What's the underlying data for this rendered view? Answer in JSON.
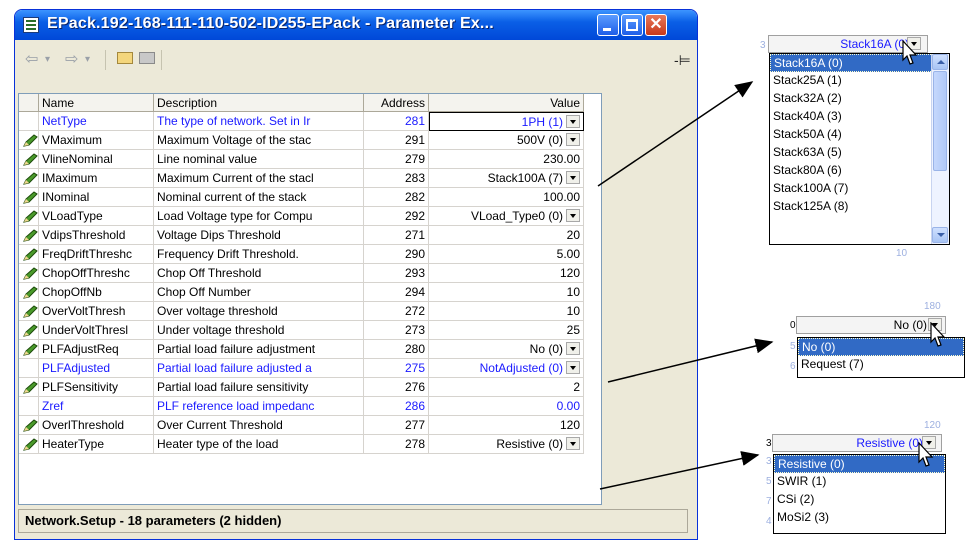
{
  "window": {
    "title": "EPack.192-168-111-110-502-ID255-EPack - Parameter Ex...",
    "close_glyph": "✕"
  },
  "toolbar": {
    "back_icon": "⇦",
    "forward_icon": "⇨",
    "dropdown_icon": "▾",
    "pin_icon": "-⊨"
  },
  "grid": {
    "columns": [
      "Name",
      "Description",
      "Address",
      "Value"
    ],
    "rows": [
      {
        "name": "NetType",
        "description": "The type of network. Set in Ir",
        "address": "281",
        "value": "1PH (1)",
        "editable": false,
        "dropdown": true
      },
      {
        "name": "VMaximum",
        "description": "Maximum Voltage of the stac",
        "address": "291",
        "value": "500V (0)",
        "editable": true,
        "dropdown": true
      },
      {
        "name": "VlineNominal",
        "description": "Line nominal value",
        "address": "279",
        "value": "230.00",
        "editable": true,
        "dropdown": false
      },
      {
        "name": "IMaximum",
        "description": "Maximum Current of the stacl",
        "address": "283",
        "value": "Stack100A (7)",
        "editable": true,
        "dropdown": true
      },
      {
        "name": "INominal",
        "description": "Nominal current of the stack",
        "address": "282",
        "value": "100.00",
        "editable": true,
        "dropdown": false
      },
      {
        "name": "VLoadType",
        "description": "Load Voltage type for Compu",
        "address": "292",
        "value": "VLoad_Type0 (0)",
        "editable": true,
        "dropdown": true
      },
      {
        "name": "VdipsThreshold",
        "description": "Voltage Dips Threshold",
        "address": "271",
        "value": "20",
        "editable": true,
        "dropdown": false
      },
      {
        "name": "FreqDriftThreshc",
        "description": "Frequency Drift Threshold.",
        "address": "290",
        "value": "5.00",
        "editable": true,
        "dropdown": false
      },
      {
        "name": "ChopOffThreshc",
        "description": "Chop Off Threshold",
        "address": "293",
        "value": "120",
        "editable": true,
        "dropdown": false
      },
      {
        "name": "ChopOffNb",
        "description": "Chop Off Number",
        "address": "294",
        "value": "10",
        "editable": true,
        "dropdown": false
      },
      {
        "name": "OverVoltThresh",
        "description": "Over voltage threshold",
        "address": "272",
        "value": "10",
        "editable": true,
        "dropdown": false
      },
      {
        "name": "UnderVoltThresl",
        "description": "Under voltage threshold",
        "address": "273",
        "value": "25",
        "editable": true,
        "dropdown": false
      },
      {
        "name": "PLFAdjustReq",
        "description": "Partial load failure adjustment",
        "address": "280",
        "value": "No (0)",
        "editable": true,
        "dropdown": true
      },
      {
        "name": "PLFAdjusted",
        "description": "Partial load failure adjusted a",
        "address": "275",
        "value": "NotAdjusted (0)",
        "editable": false,
        "dropdown": true
      },
      {
        "name": "PLFSensitivity",
        "description": "Partial load failure sensitivity",
        "address": "276",
        "value": "2",
        "editable": true,
        "dropdown": false
      },
      {
        "name": "Zref",
        "description": "PLF reference load impedanc",
        "address": "286",
        "value": "0.00",
        "editable": false,
        "dropdown": false
      },
      {
        "name": "OverlThreshold",
        "description": "Over Current Threshold",
        "address": "277",
        "value": "120",
        "editable": true,
        "dropdown": false
      },
      {
        "name": "HeaterType",
        "description": "Heater type of the load",
        "address": "278",
        "value": "Resistive (0)",
        "editable": true,
        "dropdown": true
      }
    ]
  },
  "status": {
    "text": "Network.Setup  -  18 parameters (2 hidden)"
  },
  "popups": {
    "stack": {
      "header": "Stack16A (0)",
      "options": [
        "Stack16A (0)",
        "Stack25A (1)",
        "Stack32A (2)",
        "Stack40A (3)",
        "Stack50A (4)",
        "Stack63A (5)",
        "Stack80A (6)",
        "Stack100A (7)",
        "Stack125A (8)"
      ],
      "edge_left": "3",
      "edge_bottom": "10"
    },
    "plf": {
      "header": "No (0)",
      "options": [
        "No (0)",
        "Request (7)"
      ],
      "edge_top": "180",
      "edge_left": [
        "0",
        "5",
        "6"
      ]
    },
    "heater": {
      "header": "Resistive (0)",
      "options": [
        "Resistive (0)",
        "SWIR (1)",
        "CSi (2)",
        "MoSi2 (3)"
      ],
      "edge_top": "120",
      "edge_left": [
        "3",
        "3",
        "5",
        "7",
        "4"
      ]
    }
  },
  "colors": {
    "readonly_text": "#1a1aff",
    "selection": "#316ac5",
    "titlebar": "#0a5fe6"
  }
}
